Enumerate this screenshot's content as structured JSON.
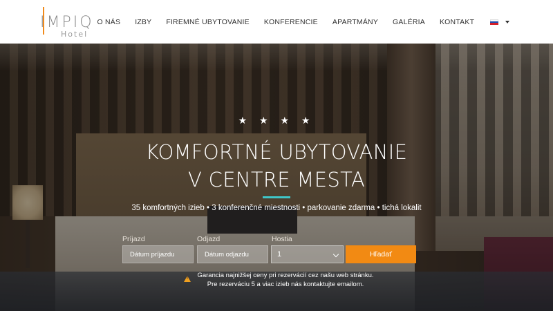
{
  "header": {
    "logo_text": "IMPIQ",
    "logo_sub": "Hotel",
    "nav": [
      "O NÁS",
      "IZBY",
      "FIREMNÉ UBYTOVANIE",
      "KONFERENCIE",
      "APARTMÁNY",
      "GALÉRIA",
      "KONTAKT"
    ],
    "language_icon": "slovak-flag-icon"
  },
  "hero": {
    "stars": "★ ★ ★ ★",
    "headline_line1": "KOMFORTNÉ UBYTOVANIE",
    "headline_line2": "V CENTRE MESTA",
    "features": "35 komfortných izieb • 3 konferenčné miestnosti • parkovanie zdarma • tichá lokalit",
    "accent_color": "#3fc7c9"
  },
  "booking": {
    "arrival_label": "Príjazd",
    "arrival_placeholder": "Dátum príjazdu",
    "departure_label": "Odjazd",
    "departure_placeholder": "Dátum odjazdu",
    "guests_label": "Hostia",
    "guests_value": "1",
    "search_label": "Hľadať",
    "search_color": "#f28a13"
  },
  "notice": {
    "line1": "Garancia najnižšej ceny pri rezervácií cez našu web stránku.",
    "line2": "Pre rezerváciu 5 a viac izieb nás kontaktujte emailom.",
    "icon": "warning-icon"
  }
}
